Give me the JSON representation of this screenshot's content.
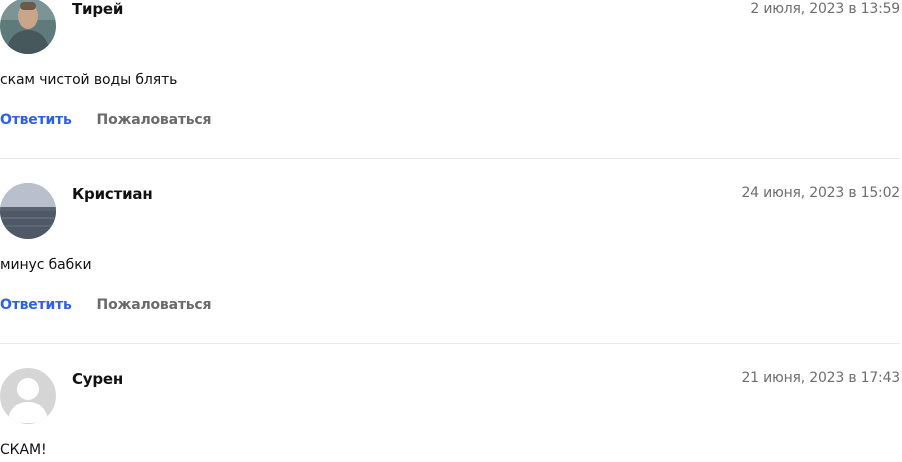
{
  "comments": [
    {
      "author": "Тирей",
      "date": "2 июля, 2023 в 13:59",
      "text": "скам чистой воды блять",
      "reply_label": "Ответить",
      "report_label": "Пожаловаться",
      "avatar": "user-photo"
    },
    {
      "author": "Кристиан",
      "date": "24 июня, 2023 в 15:02",
      "text": "минус бабки",
      "reply_label": "Ответить",
      "report_label": "Пожаловаться",
      "avatar": "lake-photo"
    },
    {
      "author": "Сурен",
      "date": "21 июня, 2023 в 17:43",
      "text": "СКАМ!",
      "avatar": "default-user-avatar"
    }
  ],
  "colors": {
    "link": "#2f5fe6",
    "muted": "#6a6a6a",
    "divider": "#e6e8ef"
  }
}
